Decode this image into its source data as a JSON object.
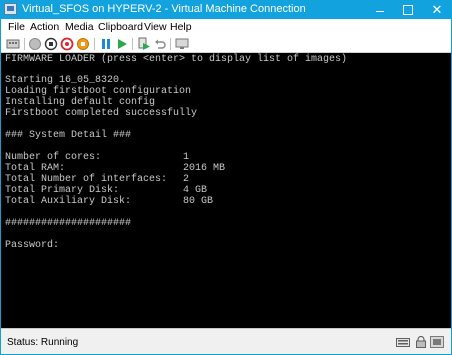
{
  "window": {
    "title": "Virtual_SFOS on HYPERV-2 - Virtual Machine Connection"
  },
  "menu": {
    "items": [
      {
        "label": "File"
      },
      {
        "label": "Action"
      },
      {
        "label": "Media"
      },
      {
        "label": "Clipboard"
      },
      {
        "label": "View"
      },
      {
        "label": "Help"
      }
    ]
  },
  "toolbar": {
    "icons": [
      "ctrl-alt-del-icon",
      "start-icon",
      "turn-off-icon",
      "shutdown-icon",
      "save-icon",
      "pause-icon",
      "resume-icon",
      "checkpoint-icon",
      "revert-icon",
      "enhanced-session-icon"
    ]
  },
  "console": {
    "header": "FIRMWARE LOADER (press <enter> to display list of images)",
    "boot_lines": [
      "Starting 16_05_8320.",
      "Loading firstboot configuration",
      "Installing default config",
      "Firstboot completed successfully"
    ],
    "section_title": "### System Detail ###",
    "details": [
      {
        "label": "Number of cores:",
        "value": "1"
      },
      {
        "label": "Total RAM:",
        "value": "2016 MB"
      },
      {
        "label": "Total Number of interfaces:",
        "value": "2"
      },
      {
        "label": "Total Primary Disk:",
        "value": "4 GB"
      },
      {
        "label": "Total Auxiliary Disk:",
        "value": "80 GB"
      }
    ],
    "divider": "#####################",
    "prompt": "Password:"
  },
  "status": {
    "text": "Status: Running"
  },
  "colors": {
    "title_bar": "#12a3de",
    "console_bg": "#000000",
    "console_fg": "#c8c8c8"
  }
}
